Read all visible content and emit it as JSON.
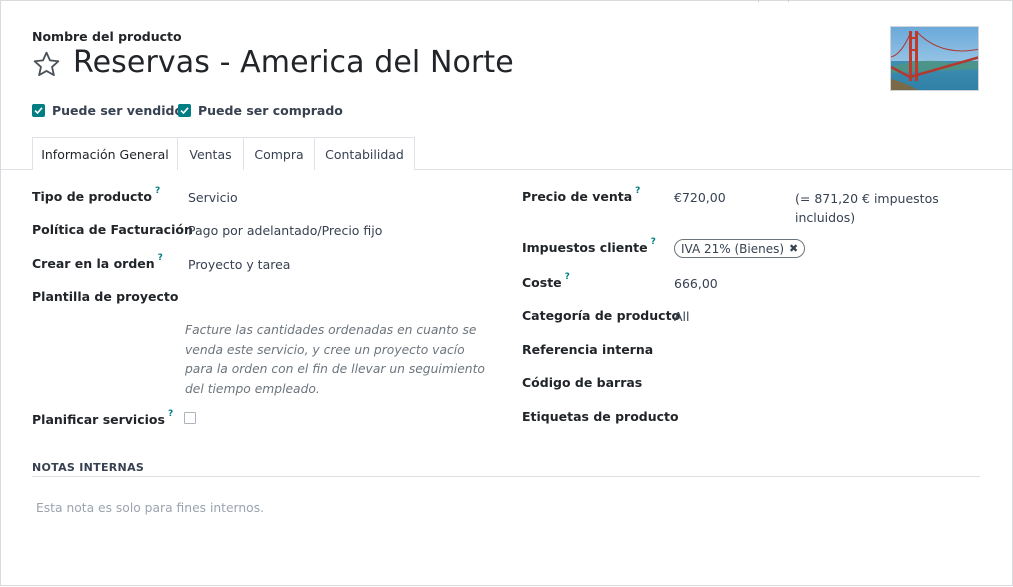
{
  "colors": {
    "accent": "#017e84",
    "text": "#212529",
    "muted": "#6c757d"
  },
  "header": {
    "name_label": "Nombre del producto",
    "product_name": "Reservas - America del Norte",
    "favorite_icon": "star-icon",
    "image": "golden-gate-bridge-photo"
  },
  "flags": {
    "can_be_sold": {
      "label": "Puede ser vendido",
      "checked": true
    },
    "can_be_purchased": {
      "label": "Puede ser comprado",
      "checked": true
    }
  },
  "tabs": [
    {
      "label": "Información General",
      "active": true
    },
    {
      "label": "Ventas",
      "active": false
    },
    {
      "label": "Compra",
      "active": false
    },
    {
      "label": "Contabilidad",
      "active": false
    }
  ],
  "left_fields": {
    "product_type": {
      "label": "Tipo de producto",
      "help": "?",
      "value": "Servicio"
    },
    "invoicing_policy": {
      "label": "Política de Facturación",
      "value": "Pago por adelantado/Precio fijo"
    },
    "create_on_order": {
      "label": "Crear en la orden",
      "help": "?",
      "value": "Proyecto y tarea"
    },
    "project_template": {
      "label": "Plantilla de proyecto",
      "value": ""
    },
    "help_text": "Facture las cantidades ordenadas en cuanto se venda este servicio, y cree un proyecto vacío para la orden con el fin de llevar un seguimiento del tiempo empleado.",
    "plan_services": {
      "label": "Planificar servicios",
      "help": "?",
      "checked": false
    }
  },
  "right_fields": {
    "sales_price": {
      "label": "Precio de venta",
      "help": "?",
      "value": "€720,00",
      "taxes_included": "(= 871,20 € impuestos incluidos)"
    },
    "customer_taxes": {
      "label": "Impuestos cliente",
      "help": "?",
      "tag": "IVA 21% (Bienes)",
      "remove_icon": "close-icon"
    },
    "cost": {
      "label": "Coste",
      "help": "?",
      "value": "666,00"
    },
    "category": {
      "label": "Categoría de producto",
      "value": "All"
    },
    "internal_ref": {
      "label": "Referencia interna",
      "value": ""
    },
    "barcode": {
      "label": "Código de barras",
      "value": ""
    },
    "tags": {
      "label": "Etiquetas de producto",
      "value": ""
    }
  },
  "notes": {
    "heading": "NOTAS INTERNAS",
    "placeholder": "Esta nota es solo para fines internos."
  }
}
